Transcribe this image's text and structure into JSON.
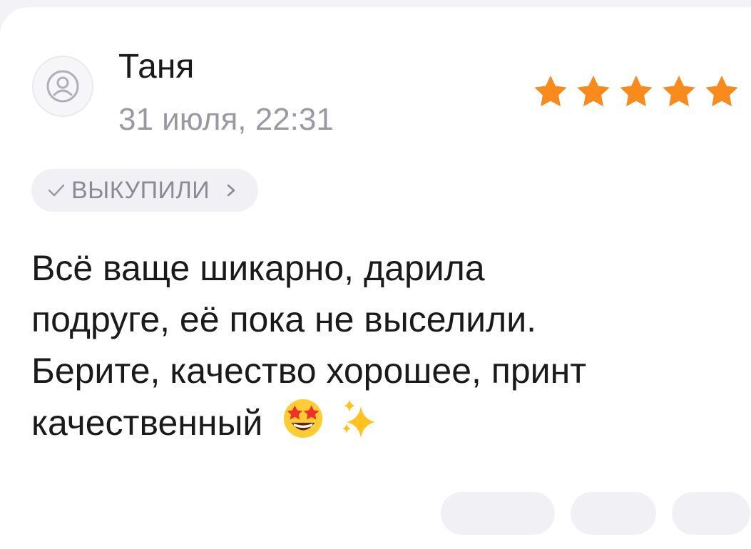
{
  "review": {
    "author": "Таня",
    "date": "31 июля, 22:31",
    "rating": 5,
    "rating_max": 5,
    "badge_label": "ВЫКУПИЛИ",
    "text_lines": [
      "Всё ваще шикарно, дарила",
      "подруге, её пока не выселили.",
      "Берите, качество хорошее, принт",
      "качественный"
    ]
  },
  "icons": {
    "avatar": "user-avatar-icon",
    "badge_check": "check-icon",
    "badge_chevron": "chevron-right-icon",
    "star": "star-icon",
    "emoji_1": "star-struck-emoji",
    "emoji_2": "sparkles-emoji"
  },
  "colors": {
    "star": "#f98a1e",
    "muted_text": "#9a98a3",
    "badge_bg": "#f1f0f4"
  }
}
